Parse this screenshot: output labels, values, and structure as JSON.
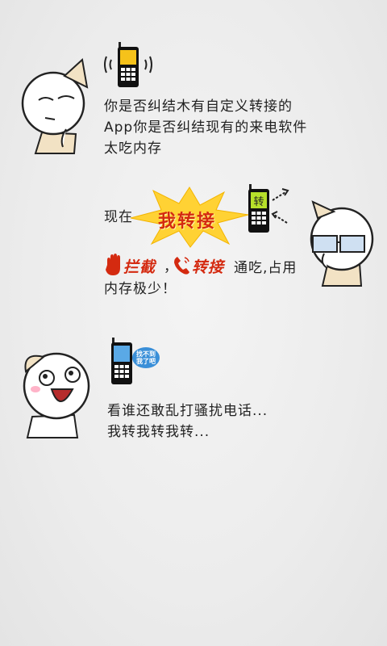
{
  "section1": {
    "line1": "你是否纠结木有自定义转接的",
    "line2": "App你是否纠结现有的来电软件",
    "line3": "太吃内存"
  },
  "section2": {
    "prefix": "现在",
    "star_brand": "我转接",
    "phone_screen_char": "转",
    "block_label": "拦截",
    "forward_label": "转接",
    "comma": "，",
    "tail1": "通吃,占用",
    "tail2": "内存极少！"
  },
  "section3": {
    "bubble_line1": "找不到",
    "bubble_line2": "我了吧",
    "line1": "看谁还敢乱打骚扰电话...",
    "line2": "我转我转我转..."
  },
  "colors": {
    "brand_red": "#d42a10",
    "star_yellow": "#ffd234",
    "phone_yellow": "#f6c21a",
    "phone_green": "#b7e02a",
    "phone_blue": "#5aa9e6"
  }
}
